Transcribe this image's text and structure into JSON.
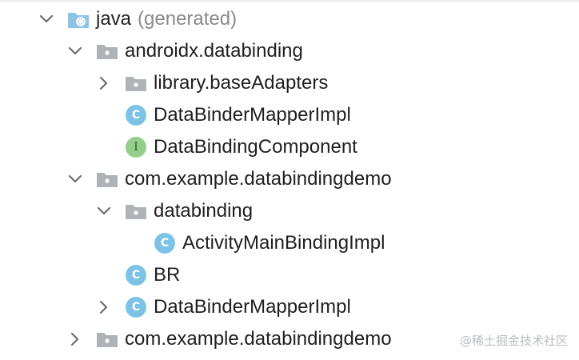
{
  "tree": {
    "items": [
      {
        "label": "java",
        "suffix": "(generated)",
        "icon": "source-root-folder-icon",
        "chevron": "expanded"
      },
      {
        "label": "androidx.databinding",
        "icon": "package-folder-icon",
        "chevron": "expanded"
      },
      {
        "label": "library.baseAdapters",
        "icon": "package-folder-icon",
        "chevron": "collapsed"
      },
      {
        "label": "DataBinderMapperImpl",
        "icon": "class-icon",
        "badge": "C"
      },
      {
        "label": "DataBindingComponent",
        "icon": "interface-icon",
        "badge": "I"
      },
      {
        "label": "com.example.databindingdemo",
        "icon": "package-folder-icon",
        "chevron": "expanded"
      },
      {
        "label": "databinding",
        "icon": "package-folder-icon",
        "chevron": "expanded"
      },
      {
        "label": "ActivityMainBindingImpl",
        "icon": "class-icon",
        "badge": "C"
      },
      {
        "label": "BR",
        "icon": "class-icon",
        "badge": "C"
      },
      {
        "label": "DataBinderMapperImpl",
        "icon": "class-icon",
        "badge": "C",
        "chevron": "collapsed"
      },
      {
        "label": "com.example.databindingdemo",
        "icon": "package-folder-icon",
        "chevron": "collapsed"
      }
    ]
  },
  "watermark": "@稀土掘金技术社区",
  "colors": {
    "class_badge": "#7ec3e6",
    "interface_badge": "#93cf8a",
    "folder": "#aeb3b8",
    "chevron": "#6e6e6e",
    "suffix_text": "#8a8a8a"
  }
}
